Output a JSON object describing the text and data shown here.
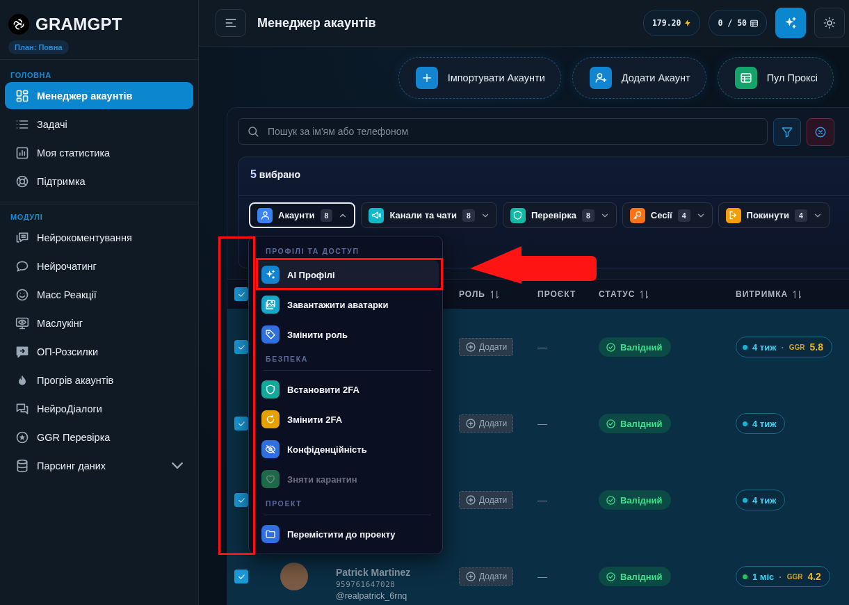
{
  "sidebar": {
    "logo": "GRAMGPT",
    "plan": "План: Повна",
    "sections": [
      {
        "title": "ГОЛОВНА",
        "items": [
          {
            "label": "Менеджер акаунтів",
            "selected": true
          },
          {
            "label": "Задачі",
            "selected": false
          },
          {
            "label": "Моя статистика",
            "selected": false
          },
          {
            "label": "Підтримка",
            "selected": false
          }
        ]
      },
      {
        "title": "МОДУЛІ",
        "items": [
          {
            "label": "Нейрокоментування",
            "selected": false
          },
          {
            "label": "Нейрочатинг",
            "selected": false
          },
          {
            "label": "Масс Реакції",
            "selected": false
          },
          {
            "label": "Маслукінг",
            "selected": false
          },
          {
            "label": "ОП-Розсилки",
            "selected": false
          },
          {
            "label": "Прогрів акаунтів",
            "selected": false
          },
          {
            "label": "НейроДіалоги",
            "selected": false
          },
          {
            "label": "GGR Перевірка",
            "selected": false
          },
          {
            "label": "Парсинг даних",
            "selected": false,
            "expanded": false
          }
        ]
      }
    ]
  },
  "topbar": {
    "title": "Менеджер акаунтів",
    "balance": "179.20",
    "proxies": "0 / 50"
  },
  "actions": [
    {
      "label": "Імпортувати Акаунти",
      "color": "#1384d0"
    },
    {
      "label": "Додати Акаунт",
      "color": "#1384d0"
    },
    {
      "label": "Пул Проксі",
      "color": "#16a36a"
    }
  ],
  "search": {
    "placeholder": "Пошук за ім'ям або телефоном"
  },
  "selection": {
    "count": "5",
    "label": "вибрано",
    "chips": [
      {
        "label": "Акаунти",
        "count": "8",
        "color": "#3b82f6",
        "expanded": true
      },
      {
        "label": "Канали та чати",
        "count": "8",
        "color": "#14b8c8",
        "expanded": false
      },
      {
        "label": "Перевірка",
        "count": "8",
        "color": "#14b8a6",
        "expanded": false
      },
      {
        "label": "Сесії",
        "count": "4",
        "color": "#f97316",
        "expanded": false
      },
      {
        "label": "Покинути",
        "count": "4",
        "color": "#f59e0b",
        "expanded": false
      }
    ]
  },
  "action_menu": {
    "groups": [
      {
        "title": "ПРОФІЛІ ТА ДОСТУП",
        "items": [
          {
            "label": "AI Профілі",
            "selected": true,
            "disabled": false,
            "color": "#1384d0"
          },
          {
            "label": "Завантажити аватарки",
            "selected": false,
            "disabled": false,
            "color": "#16a6c8"
          },
          {
            "label": "Змінити роль",
            "selected": false,
            "disabled": false,
            "color": "#2f6fe0"
          }
        ]
      },
      {
        "title": "БЕЗПЕКА",
        "items": [
          {
            "label": "Встановити 2FA",
            "selected": false,
            "disabled": false,
            "color": "#14a89a"
          },
          {
            "label": "Змінити 2FA",
            "selected": false,
            "disabled": false,
            "color": "#e6a000"
          },
          {
            "label": "Конфіденційність",
            "selected": false,
            "disabled": false,
            "color": "#2f6fe0"
          },
          {
            "label": "Зняти карантин",
            "selected": false,
            "disabled": true,
            "color": "#1c6a4a"
          }
        ]
      },
      {
        "title": "ПРОЕКТ",
        "items": [
          {
            "label": "Перемістити до проекту",
            "selected": false,
            "disabled": false,
            "color": "#2f6fe0"
          }
        ]
      }
    ]
  },
  "table": {
    "header_checked": true,
    "columns": [
      "РОЛЬ",
      "ПРОЄКТ",
      "СТАТУС",
      "ВИТРИМКА"
    ],
    "rows": [
      {
        "checked": true,
        "role": "Додати",
        "project": "—",
        "status": "Валідний",
        "hold": {
          "period": "4 тиж",
          "color": "#16b4d8",
          "separator": "·",
          "ggr_label": "GGR",
          "ggr": "5.8"
        }
      },
      {
        "checked": true,
        "role": "Додати",
        "project": "—",
        "status": "Валідний",
        "hold": {
          "period": "4 тиж",
          "color": "#16b4d8"
        }
      },
      {
        "checked": true,
        "role": "Додати",
        "project": "—",
        "status": "Валідний",
        "hold": {
          "period": "4 тиж",
          "color": "#16b4d8"
        }
      },
      {
        "checked": true,
        "name": "Patrick Martinez",
        "phone": "959761647028",
        "username": "@realpatrick_6rnq",
        "role": "Додати",
        "project": "—",
        "status": "Валідний",
        "hold": {
          "period": "1 міс",
          "color": "#22c55e",
          "separator": "·",
          "ggr_label": "GGR",
          "ggr": "4.2"
        }
      }
    ]
  }
}
